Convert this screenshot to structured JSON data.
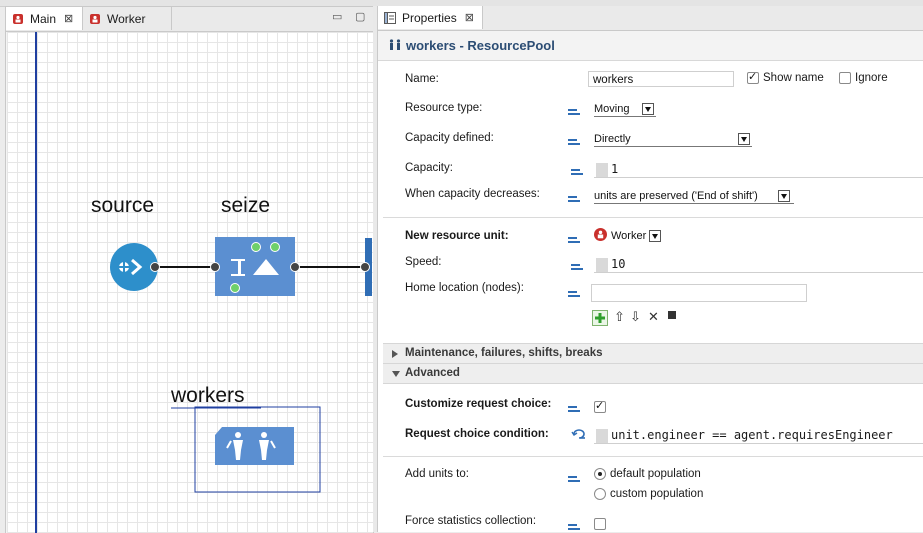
{
  "tabs": {
    "main": "Main",
    "worker": "Worker",
    "properties": "Properties"
  },
  "diagram": {
    "source_label": "source",
    "seize_label": "seize",
    "workers_label": "workers"
  },
  "properties": {
    "title": "workers - ResourcePool",
    "name_label": "Name:",
    "name_value": "workers",
    "show_name_label": "Show name",
    "show_name_checked": true,
    "ignore_label": "Ignore",
    "ignore_checked": false,
    "resource_type_label": "Resource type:",
    "resource_type_value": "Moving",
    "capacity_defined_label": "Capacity defined:",
    "capacity_defined_value": "Directly",
    "capacity_label": "Capacity:",
    "capacity_value": "1",
    "capacity_decreases_label": "When capacity decreases:",
    "capacity_decreases_value": "units are preserved ('End of shift')",
    "new_resource_unit_label": "New resource unit:",
    "new_resource_unit_value": "Worker",
    "speed_label": "Speed:",
    "speed_value": "10",
    "home_location_label": "Home location (nodes):",
    "home_location_value": "",
    "section_maintenance": "Maintenance, failures, shifts, breaks",
    "section_advanced": "Advanced",
    "customize_request_label": "Customize request choice:",
    "customize_request_checked": true,
    "request_condition_label": "Request choice condition:",
    "request_condition_value": "unit.engineer == agent.requiresEngineer",
    "add_units_label": "Add units to:",
    "add_units_options": [
      "default population",
      "custom population"
    ],
    "add_units_selected": "default population",
    "force_stats_label": "Force statistics collection:",
    "force_stats_checked": false
  },
  "colors": {
    "accent_blue": "#2f6db5",
    "block_blue": "#5b8fd1",
    "source_blue": "#2d8fcb",
    "port_green": "#6fd06a",
    "title_blue": "#2c4d74"
  }
}
